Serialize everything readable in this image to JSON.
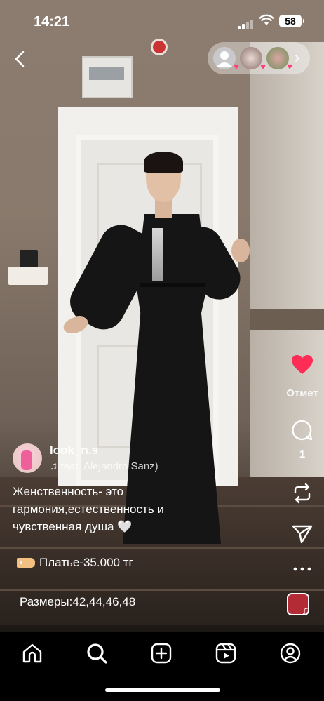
{
  "status_bar": {
    "time": "14:21",
    "battery": "58"
  },
  "top_bar": {
    "back_icon": "chevron-left-icon",
    "story_chevron": "›"
  },
  "actions": {
    "like_label": "Отмет",
    "comment_count": "1"
  },
  "post": {
    "username": "look_n.s",
    "music_text": "feat. Alejandro Sanz)",
    "caption": "Женственность- это гармония,естественность и чувственная душа 🤍",
    "price": "Платье-35.000 тг",
    "sizes": "Размеры:42,44,46,48"
  },
  "colors": {
    "like_red": "#ff2d55",
    "price_tag": "#f3c081"
  },
  "tabbar": {
    "items": [
      "home-icon",
      "search-icon",
      "create-icon",
      "reels-icon",
      "profile-icon"
    ]
  }
}
